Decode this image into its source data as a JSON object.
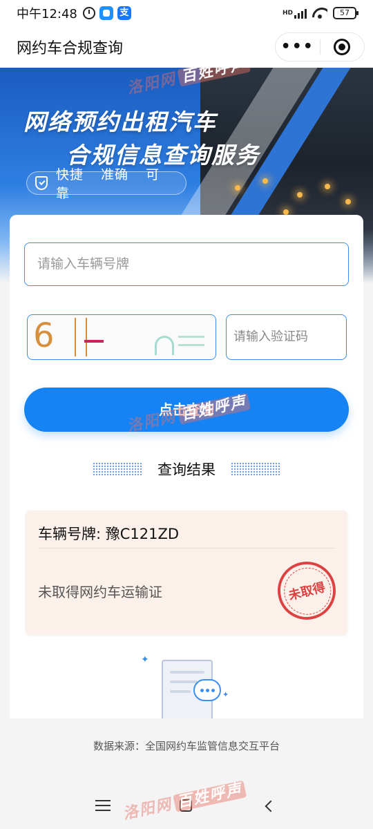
{
  "status_bar": {
    "time": "中午12:48",
    "hd_label": "HD",
    "battery": "57"
  },
  "title_bar": {
    "title": "网约车合规查询",
    "more_label": "•••"
  },
  "banner": {
    "line1": "网络预约出租汽车",
    "line2": "合规信息查询服务",
    "tags": [
      "快捷",
      "准确",
      "可靠"
    ]
  },
  "form": {
    "plate_placeholder": "请输入车辆号牌",
    "captcha_chars": "6",
    "code_placeholder": "请输入验证码",
    "submit_label": "点击查询"
  },
  "result": {
    "heading": "查询结果",
    "plate": "车辆号牌: 豫C121ZD",
    "status": "未取得网约车运输证",
    "stamp": "未取得"
  },
  "footer": {
    "source": "数据来源：全国网约车监管信息交互平台"
  },
  "watermark": {
    "site": "洛阳网",
    "tag": "百姓呼声"
  },
  "colors": {
    "primary": "#1683f5",
    "input_border": "#3b8ef0",
    "result_bg": "#fbf1ea",
    "stamp_red": "#d9302f"
  }
}
